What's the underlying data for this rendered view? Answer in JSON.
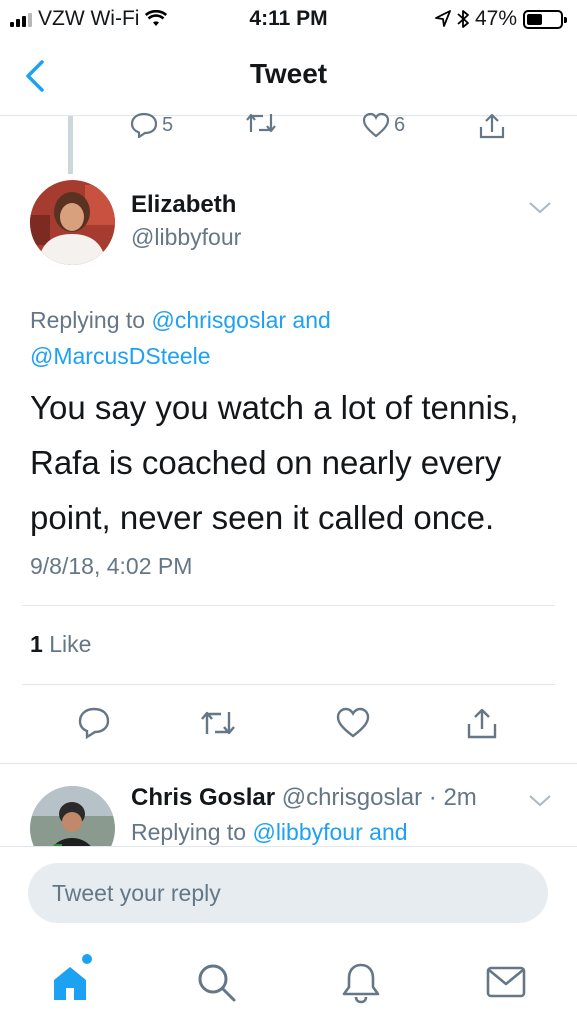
{
  "status_bar": {
    "carrier": "VZW Wi-Fi",
    "time": "4:11 PM",
    "battery_percent": "47%",
    "icons": [
      "signal-icon",
      "wifi-icon",
      "location-arrow-icon",
      "bluetooth-icon",
      "battery-icon"
    ]
  },
  "nav": {
    "title": "Tweet",
    "back_icon": "chevron-left-icon"
  },
  "previous_tweet_actions": {
    "reply_count": "5",
    "like_count": "6"
  },
  "tweet": {
    "author_name": "Elizabeth",
    "author_handle": "@libbyfour",
    "replying_prefix": "Replying to ",
    "replying_to_1": "@chrisgoslar",
    "replying_and": " and",
    "replying_to_2": "@MarcusDSteele",
    "text": "You say you watch a lot of tennis, Rafa is coached on nearly every point, never seen it called once.",
    "date": "9/8/18, 4:02 PM",
    "like_count": "1",
    "like_label": "Like"
  },
  "reply": {
    "author_name": "Chris Goslar",
    "author_handle": "@chrisgoslar",
    "time_meta": " · 2m",
    "replying_prefix": "Replying to ",
    "replying_to": "@libbyfour",
    "replying_suffix": " and"
  },
  "compose": {
    "placeholder": "Tweet your reply"
  },
  "tabs": [
    "home-icon",
    "search-icon",
    "notifications-bell-icon",
    "messages-envelope-icon"
  ],
  "colors": {
    "accent": "#1da1f2",
    "secondary_text": "#657786",
    "primary_text": "#14171a",
    "divider": "#e1e8ed"
  }
}
